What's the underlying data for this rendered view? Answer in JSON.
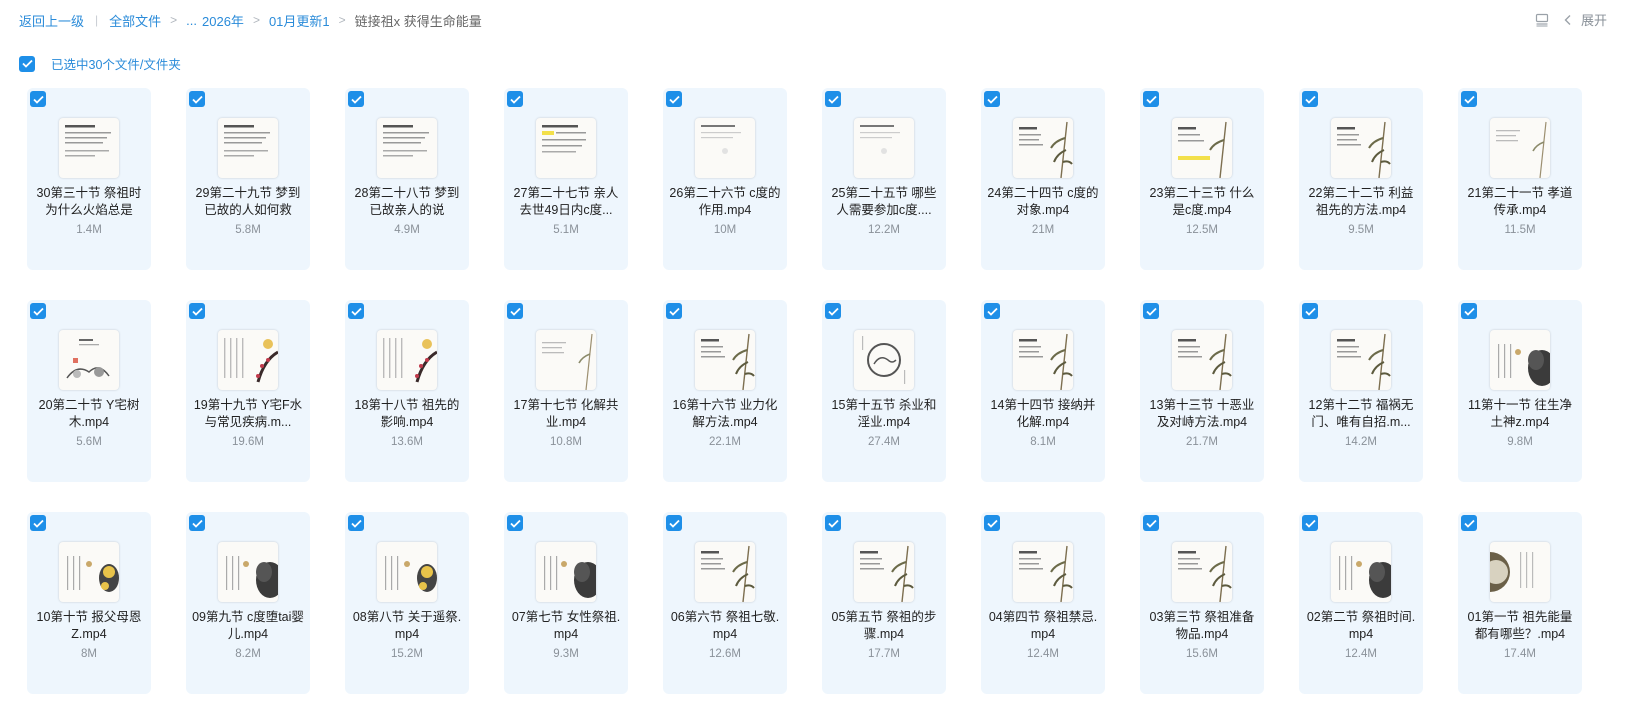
{
  "breadcrumb": {
    "back": "返回上一级",
    "all_files": "全部文件",
    "ellipsis": "...",
    "year": "2026年",
    "month": "01月更新1",
    "current": "链接祖x 获得生命能量"
  },
  "toolbar": {
    "expand_label": "展开"
  },
  "selection": {
    "label": "已选中30个文件/文件夹"
  },
  "files": [
    {
      "name": "30第三十节 祭祖时为什么火焰总是",
      "size": "1.4M",
      "thumb": "text"
    },
    {
      "name": "29第二十九节 梦到已故的人如何救",
      "size": "5.8M",
      "thumb": "text"
    },
    {
      "name": "28第二十八节 梦到已故亲人的说",
      "size": "4.9M",
      "thumb": "text"
    },
    {
      "name": "27第二十七节 亲人去世49日内c度...",
      "size": "5.1M",
      "thumb": "text-yellow"
    },
    {
      "name": "26第二十六节 c度的作用.mp4",
      "size": "10M",
      "thumb": "text-light"
    },
    {
      "name": "25第二十五节 哪些人需要参加c度....",
      "size": "12.2M",
      "thumb": "text-light"
    },
    {
      "name": "24第二十四节 c度的对象.mp4",
      "size": "21M",
      "thumb": "bamboo"
    },
    {
      "name": "23第二十三节 什么是c度.mp4",
      "size": "12.5M",
      "thumb": "bamboo-yellow"
    },
    {
      "name": "22第二十二节 利益祖先的方法.mp4",
      "size": "9.5M",
      "thumb": "bamboo"
    },
    {
      "name": "21第二十一节 孝道传承.mp4",
      "size": "11.5M",
      "thumb": "bamboo-light"
    },
    {
      "name": "20第二十节 Y宅树木.mp4",
      "size": "5.6M",
      "thumb": "tree"
    },
    {
      "name": "19第十九节 Y宅F水与常见疾病.m...",
      "size": "19.6M",
      "thumb": "plum"
    },
    {
      "name": "18第十八节 祖先的影响.mp4",
      "size": "13.6M",
      "thumb": "plum"
    },
    {
      "name": "17第十七节 化解共业.mp4",
      "size": "10.8M",
      "thumb": "bamboo-light"
    },
    {
      "name": "16第十六节 业力化解方法.mp4",
      "size": "22.1M",
      "thumb": "bamboo"
    },
    {
      "name": "15第十五节 杀业和淫业.mp4",
      "size": "27.4M",
      "thumb": "circle"
    },
    {
      "name": "14第十四节 接纳并化解.mp4",
      "size": "8.1M",
      "thumb": "bamboo"
    },
    {
      "name": "13第十三节 十恶业及对峙方法.mp4",
      "size": "21.7M",
      "thumb": "bamboo"
    },
    {
      "name": "12第十二节 福祸无门、唯有自招.m...",
      "size": "14.2M",
      "thumb": "bamboo"
    },
    {
      "name": "11第十一节 往生净土神z.mp4",
      "size": "9.8M",
      "thumb": "ink"
    },
    {
      "name": "10第十节 报父母恩Z.mp4",
      "size": "8M",
      "thumb": "flower"
    },
    {
      "name": "09第九节 c度堕tai婴儿.mp4",
      "size": "8.2M",
      "thumb": "ink"
    },
    {
      "name": "08第八节 关于遥祭.mp4",
      "size": "15.2M",
      "thumb": "flower"
    },
    {
      "name": "07第七节 女性祭祖.mp4",
      "size": "9.3M",
      "thumb": "ink"
    },
    {
      "name": "06第六节 祭祖七敬.mp4",
      "size": "12.6M",
      "thumb": "bamboo"
    },
    {
      "name": "05第五节 祭祖的步骤.mp4",
      "size": "17.7M",
      "thumb": "bamboo"
    },
    {
      "name": "04第四节 祭祖禁忌.mp4",
      "size": "12.4M",
      "thumb": "bamboo"
    },
    {
      "name": "03第三节 祭祖准备物品.mp4",
      "size": "15.6M",
      "thumb": "bamboo"
    },
    {
      "name": "02第二节 祭祖时间.mp4",
      "size": "12.4M",
      "thumb": "ink"
    },
    {
      "name": "01第一节 祖先能量都有哪些？.mp4",
      "size": "17.4M",
      "thumb": "circle-left"
    }
  ]
}
